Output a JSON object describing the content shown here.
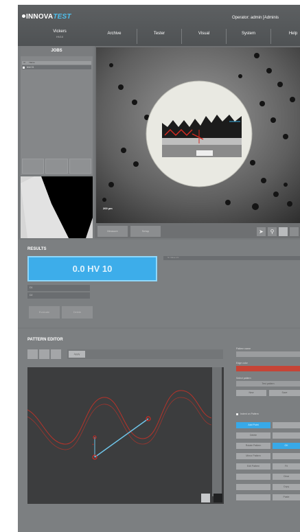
{
  "header": {
    "brand_prefix": "INNOVA",
    "brand_accent": "TEST",
    "operator_label": "Operator: admin",
    "role_label": "[Adminis",
    "mode_label": "Vickers",
    "mode_sub": "HV10",
    "tabs": [
      "Archive",
      "Tester",
      "Visual",
      "System",
      "Help"
    ]
  },
  "jobs": {
    "title": "JOBS",
    "columns": [
      "Id",
      "Name"
    ],
    "rows": [
      {
        "checked": true,
        "name": "test 01"
      }
    ]
  },
  "view": {
    "scale_label": "200 µm",
    "toolbar": {
      "left_buttons": [
        "Measure",
        "Setup"
      ],
      "icons": [
        "cursor-icon",
        "zoom-icon",
        "focus-icon",
        "grid-icon"
      ]
    }
  },
  "results": {
    "title": "RESULTS",
    "hardness_value": "0.0 HV 10",
    "columns_header": "Nr   Value   HV",
    "fields": [
      "D1",
      "D2"
    ],
    "buttons": [
      "Evaluate",
      "Delete"
    ]
  },
  "pattern": {
    "title": "PATTERN EDITOR",
    "toolbar_button": "Apply",
    "labels": {
      "pattern_name": "Pattern name",
      "edge_color": "Edge color",
      "select_pattern": "Select pattern"
    },
    "select_value": "Test pattern",
    "side_buttons_row": [
      "New",
      "Save"
    ],
    "checkbox_label": "Indent on Pattern",
    "grid_buttons": [
      {
        "label": "Add Point",
        "active": true
      },
      {
        "label": "",
        "active": false
      },
      {
        "label": "Delete",
        "active": false
      },
      {
        "label": "",
        "active": false
      },
      {
        "label": "Rotate Pattern",
        "active": false
      },
      {
        "label": "OK",
        "active": true
      },
      {
        "label": "Mirror Pattern",
        "active": false
      },
      {
        "label": "",
        "active": false
      },
      {
        "label": "Edit Pattern",
        "active": false
      },
      {
        "label": "Fit",
        "active": false
      },
      {
        "label": "",
        "active": false
      },
      {
        "label": "Clear",
        "active": false
      },
      {
        "label": "",
        "active": false
      },
      {
        "label": "Copy",
        "active": false
      },
      {
        "label": "",
        "active": false
      },
      {
        "label": "Paste",
        "active": false
      }
    ]
  },
  "colors": {
    "accent_blue": "#3dadea",
    "edge_red": "#c64436",
    "panel_gray": "#7c7f81"
  }
}
